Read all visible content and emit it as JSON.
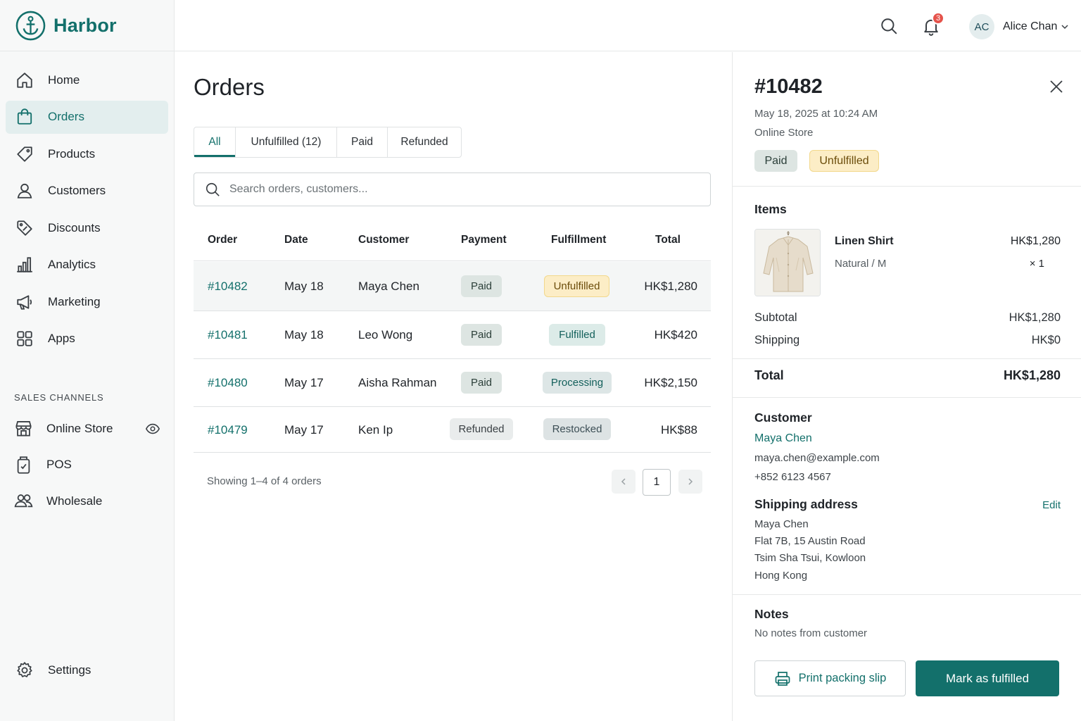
{
  "app": {
    "name": "Harbor"
  },
  "sidebar": {
    "items": [
      {
        "label": "Home",
        "icon": "home-icon"
      },
      {
        "label": "Orders",
        "icon": "shopping-bag-icon",
        "active": true
      },
      {
        "label": "Products",
        "icon": "tag-icon"
      },
      {
        "label": "Customers",
        "icon": "person-icon"
      },
      {
        "label": "Discounts",
        "icon": "discount-tag-icon"
      },
      {
        "label": "Analytics",
        "icon": "bar-chart-icon"
      },
      {
        "label": "Marketing",
        "icon": "megaphone-icon"
      },
      {
        "label": "Apps",
        "icon": "grid-icon"
      }
    ],
    "section_title": "SALES CHANNELS",
    "channels": [
      {
        "label": "Online Store",
        "icon": "storefront-icon",
        "trailing": "eye-icon"
      },
      {
        "label": "POS",
        "icon": "pos-terminal-icon"
      },
      {
        "label": "Wholesale",
        "icon": "people-icon"
      }
    ],
    "settings": {
      "label": "Settings",
      "icon": "gear-icon"
    }
  },
  "topbar": {
    "notification_count": "3",
    "user_initials": "AC",
    "user_name": "Alice Chan"
  },
  "orders": {
    "title": "Orders",
    "tabs": [
      {
        "label": "All",
        "active": true
      },
      {
        "label": "Unfulfilled (12)"
      },
      {
        "label": "Paid"
      },
      {
        "label": "Refunded"
      }
    ],
    "search_placeholder": "Search orders, customers...",
    "columns": [
      "Order",
      "Date",
      "Customer",
      "Payment",
      "Fulfillment",
      "Total"
    ],
    "rows": [
      {
        "order": "#10482",
        "date": "May 18",
        "customer": "Maya Chen",
        "payment": "Paid",
        "fulfillment": "Unfulfilled",
        "total": "HK$1,280",
        "selected": true
      },
      {
        "order": "#10481",
        "date": "May 18",
        "customer": "Leo Wong",
        "payment": "Paid",
        "fulfillment": "Fulfilled",
        "total": "HK$420"
      },
      {
        "order": "#10480",
        "date": "May 17",
        "customer": "Aisha Rahman",
        "payment": "Paid",
        "fulfillment": "Processing",
        "total": "HK$2,150"
      },
      {
        "order": "#10479",
        "date": "May 17",
        "customer": "Ken Ip",
        "payment": "Refunded",
        "fulfillment": "Restocked",
        "total": "HK$88"
      }
    ],
    "footer": {
      "showing": "Showing 1–4 of 4 orders",
      "page": "1"
    }
  },
  "detail": {
    "order_number": "#10482",
    "date": "May 18, 2025 at 10:24 AM",
    "source": "Online Store",
    "payment_badge": "Paid",
    "fulfillment_badge": "Unfulfilled",
    "items_title": "Items",
    "item": {
      "name": "Linen Shirt",
      "variant": "Natural / M",
      "price": "HK$1,280",
      "qty": "× 1"
    },
    "subtotal_label": "Subtotal",
    "subtotal": "HK$1,280",
    "shipping_label": "Shipping",
    "shipping": "HK$0",
    "total_label": "Total",
    "total": "HK$1,280",
    "customer_title": "Customer",
    "customer_name": "Maya Chen",
    "customer_email": "maya.chen@example.com",
    "customer_phone": "+852 6123 4567",
    "shipping_title": "Shipping address",
    "edit_label": "Edit",
    "address": [
      "Maya Chen",
      "Flat 7B, 15 Austin Road",
      "Tsim Sha Tsui, Kowloon",
      "Hong Kong"
    ],
    "notes_title": "Notes",
    "notes": "No notes from customer",
    "print_label": "Print packing slip",
    "fulfill_label": "Mark as fulfilled"
  },
  "colors": {
    "accent": "#13706b",
    "badge_red": "#e5534b",
    "unfulfilled_bg": "#fcedc6"
  }
}
